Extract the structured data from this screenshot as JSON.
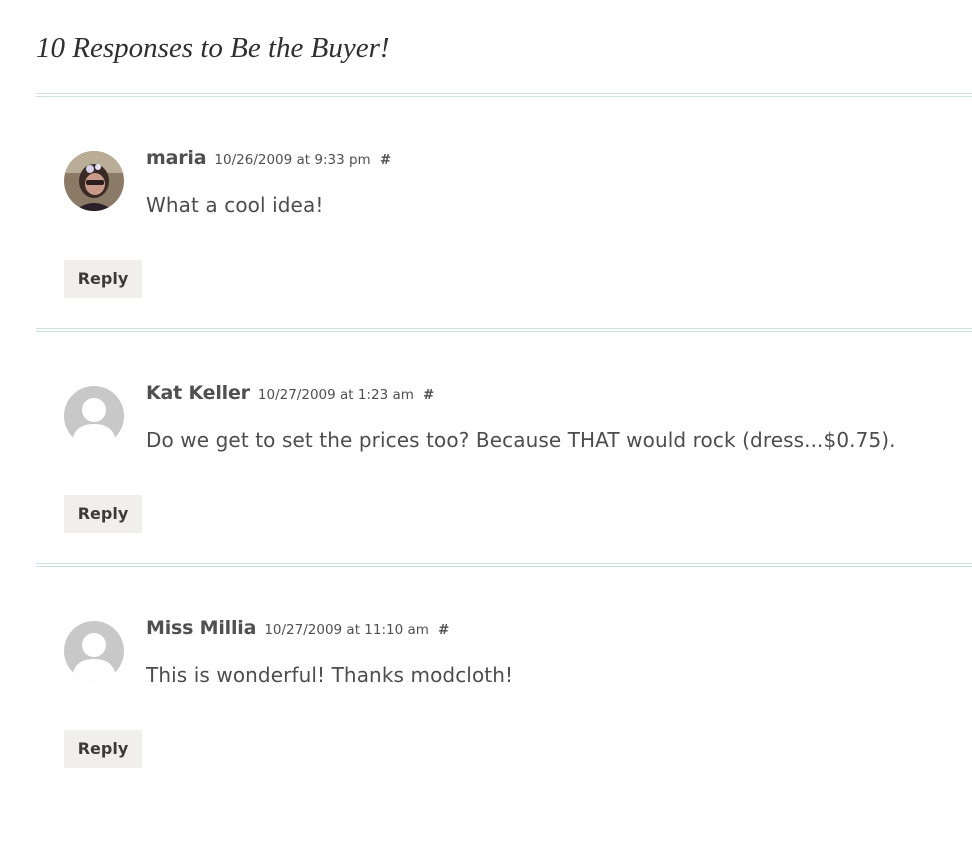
{
  "heading": "10 Responses to Be the Buyer!",
  "comments": [
    {
      "author": "maria",
      "date": "10/26/2009 at 9:33 pm",
      "permalink": "#",
      "text": "What a cool idea!",
      "reply_label": "Reply",
      "avatar": "user-photo"
    },
    {
      "author": "Kat Keller",
      "date": "10/27/2009 at 1:23 am",
      "permalink": "#",
      "text": "Do we get to set the prices too? Because THAT would rock (dress...$0.75).",
      "reply_label": "Reply",
      "avatar": "default-avatar-icon"
    },
    {
      "author": "Miss Millia",
      "date": "10/27/2009 at 11:10 am",
      "permalink": "#",
      "text": "This is wonderful! Thanks modcloth!",
      "reply_label": "Reply",
      "avatar": "default-avatar-icon"
    }
  ],
  "colors": {
    "divider": "#cde2dd",
    "reply_bg": "#f0efec",
    "avatar_placeholder": "#c8c8c8"
  }
}
